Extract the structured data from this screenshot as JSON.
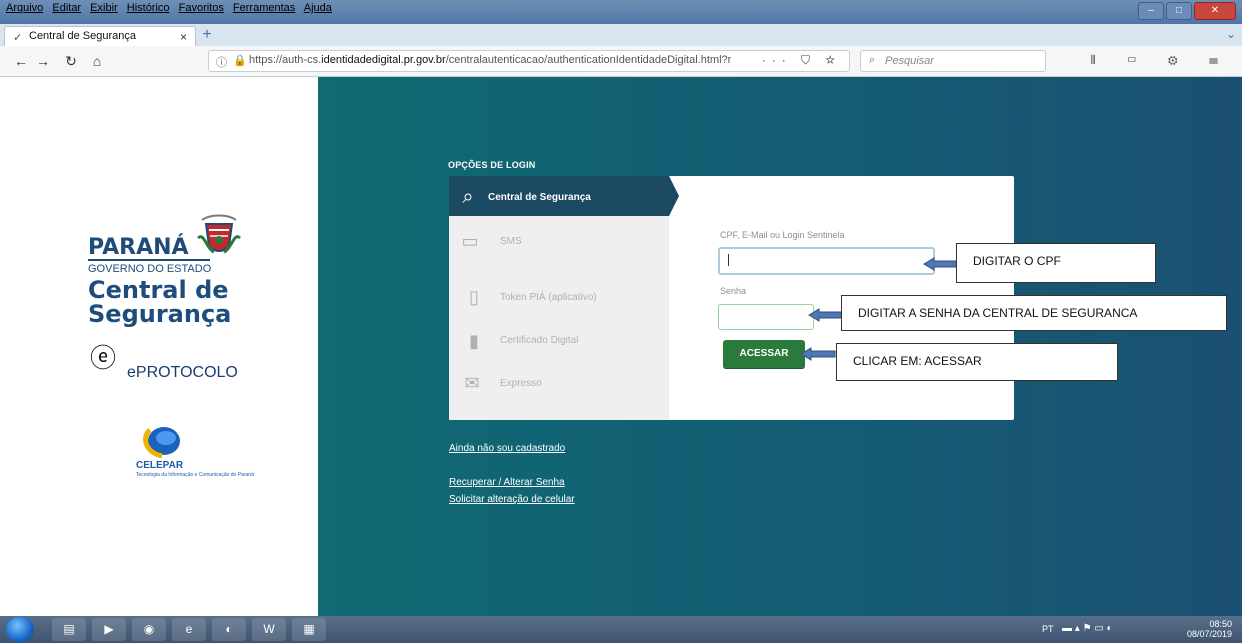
{
  "browser": {
    "menu_items": [
      "Arquivo",
      "Editar",
      "Exibir",
      "Histórico",
      "Favoritos",
      "Ferramentas",
      "Ajuda"
    ],
    "tab": {
      "title": "Central de Segurança",
      "close": "×"
    },
    "new_tab": "+",
    "url": {
      "prefix": "https://auth-cs.",
      "domain": "identidadedigital.pr.gov.br",
      "path": "/centralautenticacao/authenticationIdentidadeDigital.html?r"
    },
    "page_actions": "··· ⛉ ☆",
    "search_placeholder": "Pesquisar",
    "toolbar_icons": "⫴ ▭ ⚙ ☰"
  },
  "left_brand": {
    "parana": "PARANÁ",
    "governo": "GOVERNO DO ESTADO",
    "central_line1": "Central de",
    "central_line2": "Segurança",
    "eprotocolo_e": "e",
    "eprotocolo_rest": "PROTOCOLO",
    "celepar": "CELEPAR",
    "celepar_sub": "Tecnologia da Informação e Comunicação do Paraná"
  },
  "login": {
    "title": "OPÇÕES DE LOGIN",
    "options": [
      {
        "label": "Central de Segurança",
        "icon": "search-id-icon",
        "active": true
      },
      {
        "label": "SMS",
        "icon": "sms-icon",
        "active": false
      },
      {
        "label": "Token PIÁ (aplicativo)",
        "icon": "phone-icon",
        "active": false
      },
      {
        "label": "Certificado Digital",
        "icon": "usb-token-icon",
        "active": false
      },
      {
        "label": "Expresso",
        "icon": "mail-icon",
        "active": false
      }
    ],
    "cpf_label": "CPF, E-Mail ou Login Sentinela",
    "senha_label": "Senha",
    "button": "ACESSAR"
  },
  "links": [
    "Ainda não sou cadastrado",
    "Recuperar / Alterar Senha",
    "Solicitar alteração de celular"
  ],
  "annotations": [
    "DIGITAR O CPF",
    "DIGITAR A SENHA DA CENTRAL DE SEGURANCA",
    "CLICAR EM: ACESSAR"
  ],
  "taskbar": {
    "lang": "PT",
    "time": "08:50",
    "date": "08/07/2019"
  }
}
